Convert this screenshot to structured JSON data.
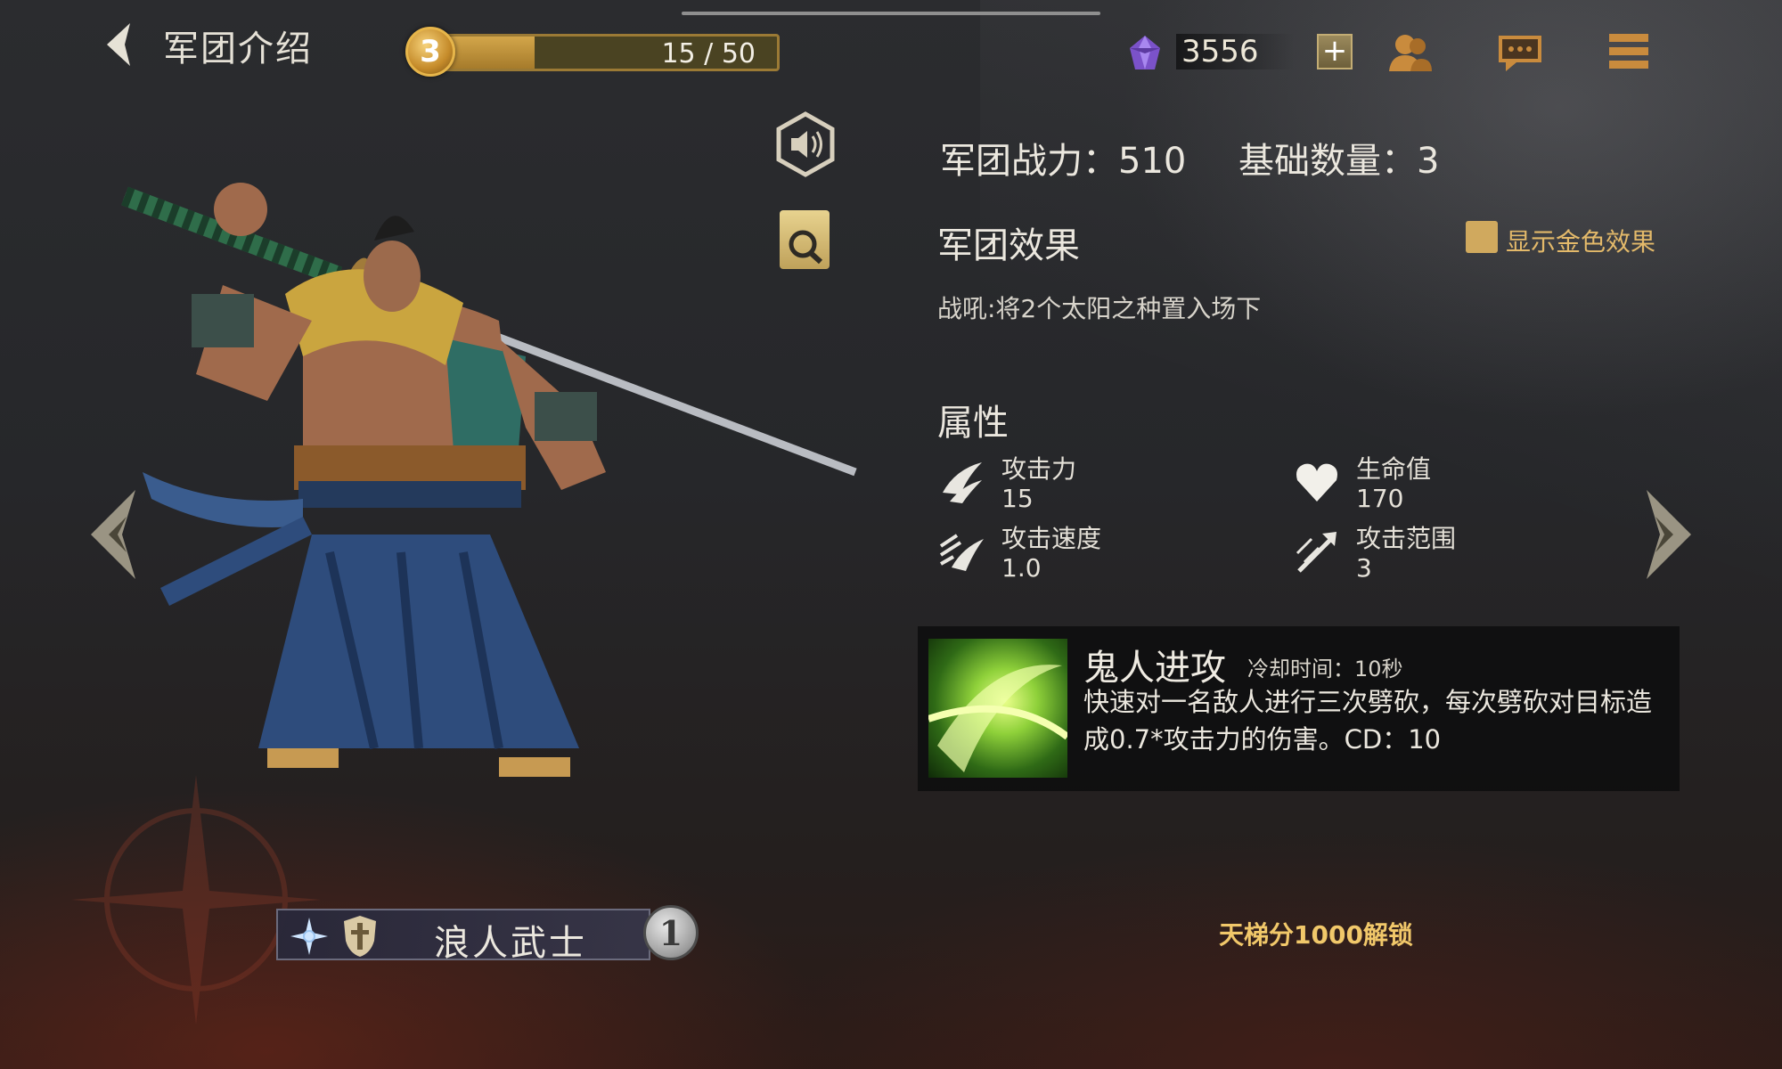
{
  "header": {
    "back_icon": "back-arrow-icon",
    "title": "军团介绍",
    "level": "3",
    "xp_text": "15 / 50",
    "xp_progress": 0.3,
    "currency_icon": "purple-gem-icon",
    "currency_value": "3556",
    "plus_label": "+",
    "icons": [
      "friends-icon",
      "chat-icon",
      "menu-icon"
    ]
  },
  "stats": {
    "power_label": "军团战力",
    "power_value": "510",
    "power_text": "军团战力：510",
    "base_count_text": "基础数量：3"
  },
  "effect": {
    "title": "军团效果",
    "gold_toggle_label": "显示金色效果",
    "description": "战吼:将2个太阳之种置入场下"
  },
  "attributes": {
    "title": "属性",
    "items": [
      {
        "icon": "attack-icon",
        "label": "攻击力",
        "value": "15"
      },
      {
        "icon": "heart-icon",
        "label": "生命值",
        "value": "170"
      },
      {
        "icon": "attack-speed-icon",
        "label": "攻击速度",
        "value": "1.0"
      },
      {
        "icon": "attack-range-icon",
        "label": "攻击范围",
        "value": "3"
      }
    ]
  },
  "skill": {
    "name": "鬼人进攻",
    "cooldown": "冷却时间：10秒",
    "description": "快速对一名敌人进行三次劈砍，每次劈砍对目标造成0.7*攻击力的伤害。CD：10"
  },
  "unit": {
    "name": "浪人武士",
    "cost": "1"
  },
  "unlock_text": "天梯分1000解锁",
  "colors": {
    "gold": "#d0a95e",
    "unlock": "#f1c86a",
    "skill_green": "#8fd13a"
  }
}
